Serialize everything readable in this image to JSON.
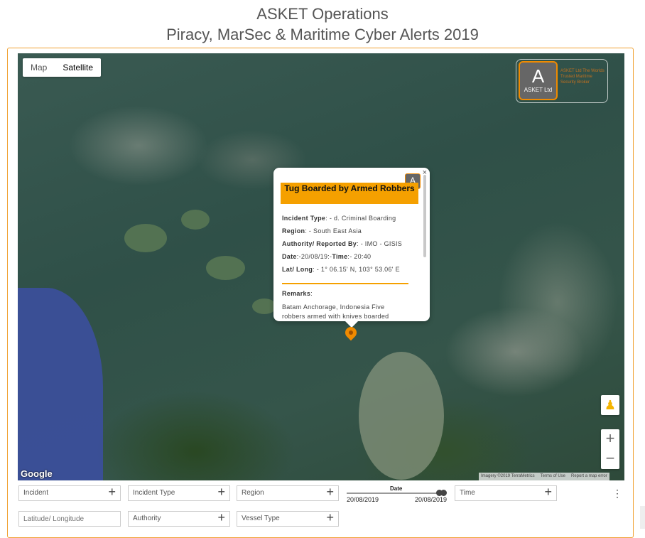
{
  "header": {
    "title": "ASKET Operations",
    "subtitle": "Piracy, MarSec & Maritime Cyber Alerts 2019"
  },
  "map": {
    "type_control": {
      "map_label": "Map",
      "satellite_label": "Satellite",
      "selected": "Satellite"
    },
    "google_label": "Google",
    "attribution": [
      "Imagery ©2019 TerraMetrics",
      "Terms of Use",
      "Report a map error"
    ],
    "zoom_in": "+",
    "zoom_out": "−",
    "pegman": "♟"
  },
  "logo": {
    "letter": "A",
    "sub": "ASKET Ltd",
    "tagline": "ASKET Ltd The Worlds Trusted Maritime Security Broker"
  },
  "popup": {
    "close": "×",
    "logo_letter": "A",
    "title": "Tug Boarded by Armed Robbers",
    "incident_type_label": "Incident Type",
    "incident_type_value": ": - d. Criminal Boarding",
    "region_label": "Region",
    "region_value": ": - South East Asia",
    "authority_label": "Authority/ Reported By",
    "authority_value": ": - IMO - GISIS",
    "date_label": "Date",
    "date_value": ":-20/08/19:-",
    "time_label": "Time",
    "time_value": ":- 20:40",
    "latlong_label": "Lat/ Long",
    "latlong_value": ": - 1° 06.15' N, 103° 53.06' E",
    "remarks_label": "Remarks",
    "remarks_value": "Batam Anchorage, Indonesia Five robbers armed with knives boarded"
  },
  "filters": {
    "incident": "Incident",
    "incident_type": "Incident Type",
    "region": "Region",
    "time": "Time",
    "latlong_placeholder": "Latitude/ Longitude",
    "authority": "Authority",
    "vessel_type": "Vessel Type",
    "date_label": "Date",
    "date_from": "20/08/2019",
    "date_to": "20/08/2019"
  }
}
